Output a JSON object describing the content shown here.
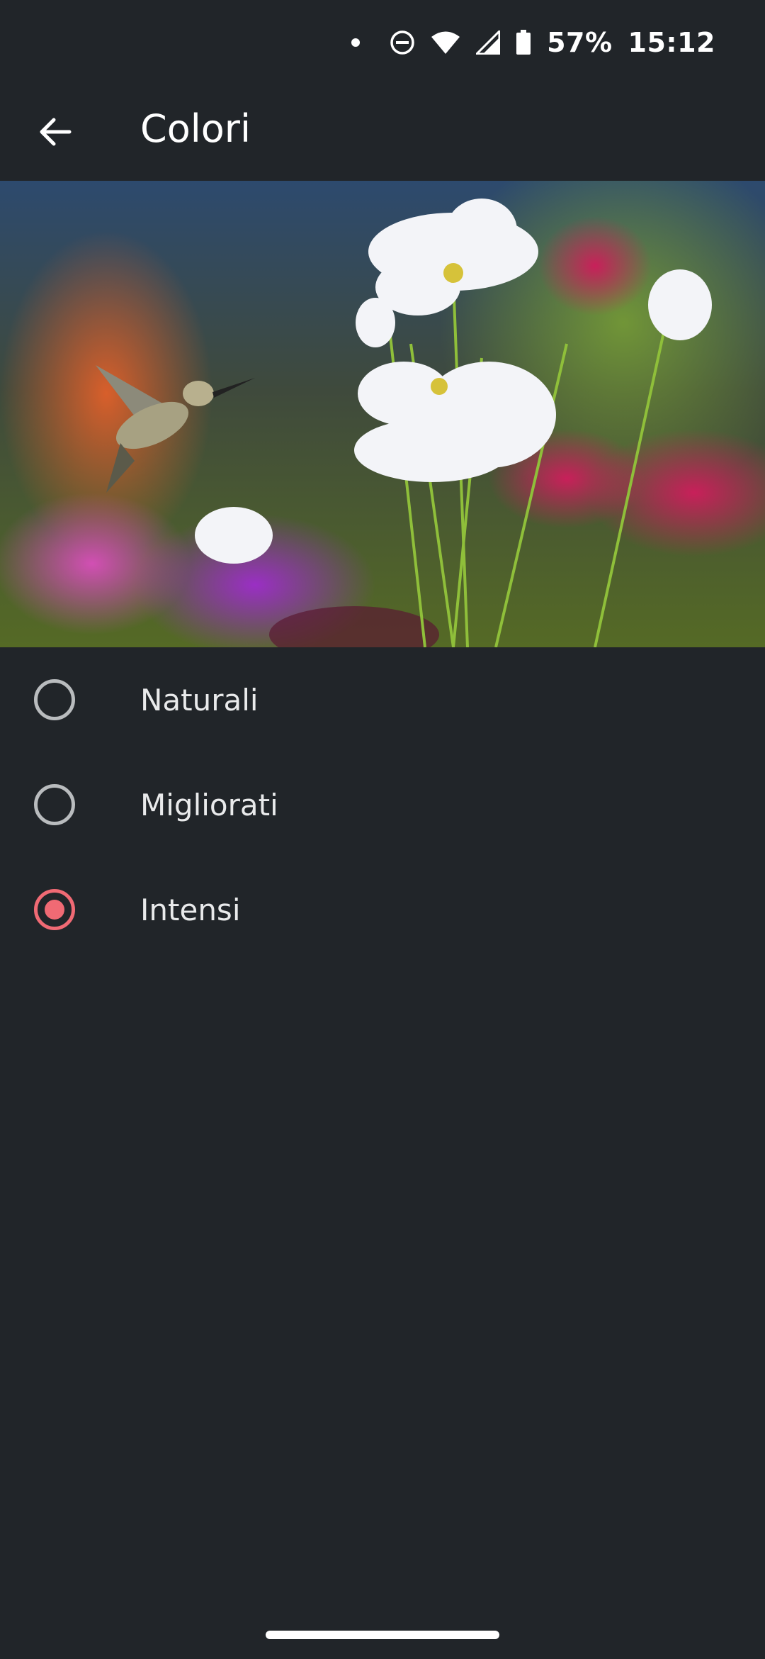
{
  "status_bar": {
    "battery_percent": "57%",
    "time": "15:12",
    "icons": [
      "notification-dot-icon",
      "do-not-disturb-icon",
      "wifi-icon",
      "cell-signal-icon",
      "battery-icon"
    ]
  },
  "app_bar": {
    "title": "Colori",
    "back_icon": "arrow-back-icon"
  },
  "hero_image": {
    "subject": "hummingbird-and-flowers-photo"
  },
  "options": [
    {
      "label": "Naturali",
      "selected": false
    },
    {
      "label": "Migliorati",
      "selected": false
    },
    {
      "label": "Intensi",
      "selected": true
    }
  ],
  "colors": {
    "background": "#212529",
    "accent": "#f06a74",
    "radio_off": "#b9bcbe"
  }
}
